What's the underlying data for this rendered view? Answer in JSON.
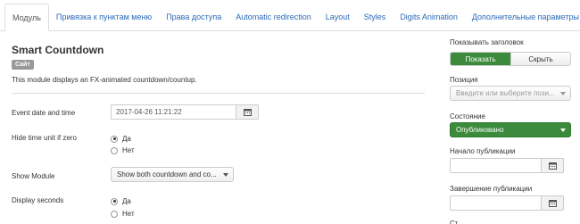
{
  "tabs": [
    {
      "label": "Модуль",
      "active": true
    },
    {
      "label": "Привязка к пунктам меню"
    },
    {
      "label": "Права доступа"
    },
    {
      "label": "Automatic redirection"
    },
    {
      "label": "Layout"
    },
    {
      "label": "Styles"
    },
    {
      "label": "Digits Animation"
    },
    {
      "label": "Дополнительные параметры"
    }
  ],
  "module": {
    "title": "Smart Countdown",
    "badge": "Сайт",
    "description": "This module displays an FX-animated countdown/countup."
  },
  "fields": {
    "event_date": {
      "label": "Event date and time",
      "value": "2017-04-26 11:21:22"
    },
    "hide_time_unit": {
      "label": "Hide time unit if zero",
      "options": [
        "Да",
        "Нет"
      ],
      "selected": "Да"
    },
    "show_module": {
      "label": "Show Module",
      "value": "Show both countdown and co..."
    },
    "display_seconds": {
      "label": "Display seconds",
      "options": [
        "Да",
        "Нет"
      ],
      "selected": "Да"
    }
  },
  "sidebar": {
    "show_title": {
      "label": "Показывать заголовок",
      "on_label": "Показать",
      "off_label": "Скрыть",
      "selected": "Показать"
    },
    "position": {
      "label": "Позиция",
      "placeholder": "Введите или выберите пози..."
    },
    "state": {
      "label": "Состояние",
      "value": "Опубликовано"
    },
    "publish_start": {
      "label": "Начало публикации",
      "value": ""
    },
    "publish_end": {
      "label": "Завершение публикации",
      "value": ""
    },
    "next_label_partial": "Ст"
  },
  "colors": {
    "link": "#2a69b8",
    "success": "#3c8b3c",
    "badge": "#999999"
  }
}
